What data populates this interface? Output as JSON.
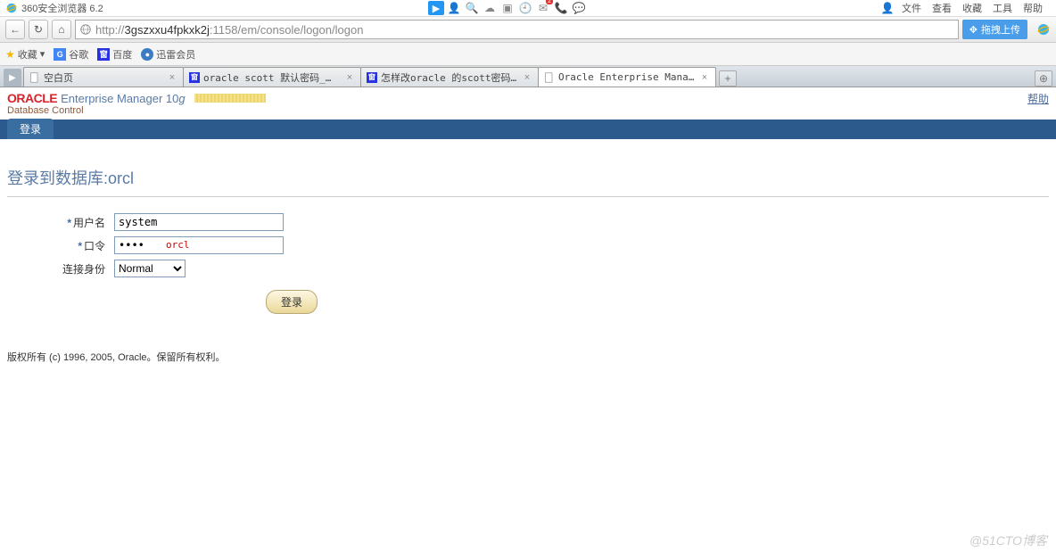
{
  "window": {
    "title": "360安全浏览器 6.2"
  },
  "top_menu": {
    "items": [
      "文件",
      "查看",
      "收藏",
      "工具",
      "帮助"
    ]
  },
  "address_bar": {
    "url_prefix": "http://",
    "url_host": "3gszxxu4fpkxk2j",
    "url_suffix": ":1158/em/console/logon/logon",
    "upload_label": "拖拽上传"
  },
  "bookmarks": {
    "fav_label": "收藏",
    "dropdown": "▾",
    "items": [
      {
        "label": "谷歌",
        "icon": "G"
      },
      {
        "label": "百度",
        "icon": "窗"
      },
      {
        "label": "迅雷会员",
        "icon": "●"
      }
    ]
  },
  "tabs": [
    {
      "title": "空白页",
      "icon": "blank",
      "active": false
    },
    {
      "title": "oracle scott 默认密码_百度搜",
      "icon": "baidu",
      "active": false
    },
    {
      "title": "怎样改oracle 的scott密码为默",
      "icon": "baidu",
      "active": false
    },
    {
      "title": "Oracle Enterprise Manager",
      "icon": "blank",
      "active": true
    }
  ],
  "em": {
    "logo_text": "ORACLE",
    "title": "Enterprise Manager 10",
    "title_suffix": "g",
    "subtitle": "Database Control",
    "help_label": "帮助",
    "nav_tab": "登录",
    "heading": "登录到数据库:orcl",
    "form": {
      "username_label": "用户名",
      "username_value": "system",
      "password_label": "口令",
      "password_value": "••••",
      "password_annotation": "orcl",
      "role_label": "连接身份",
      "role_value": "Normal",
      "submit_label": "登录"
    },
    "footer": "版权所有 (c) 1996, 2005, Oracle。保留所有权利。"
  },
  "watermark": "@51CTO博客"
}
